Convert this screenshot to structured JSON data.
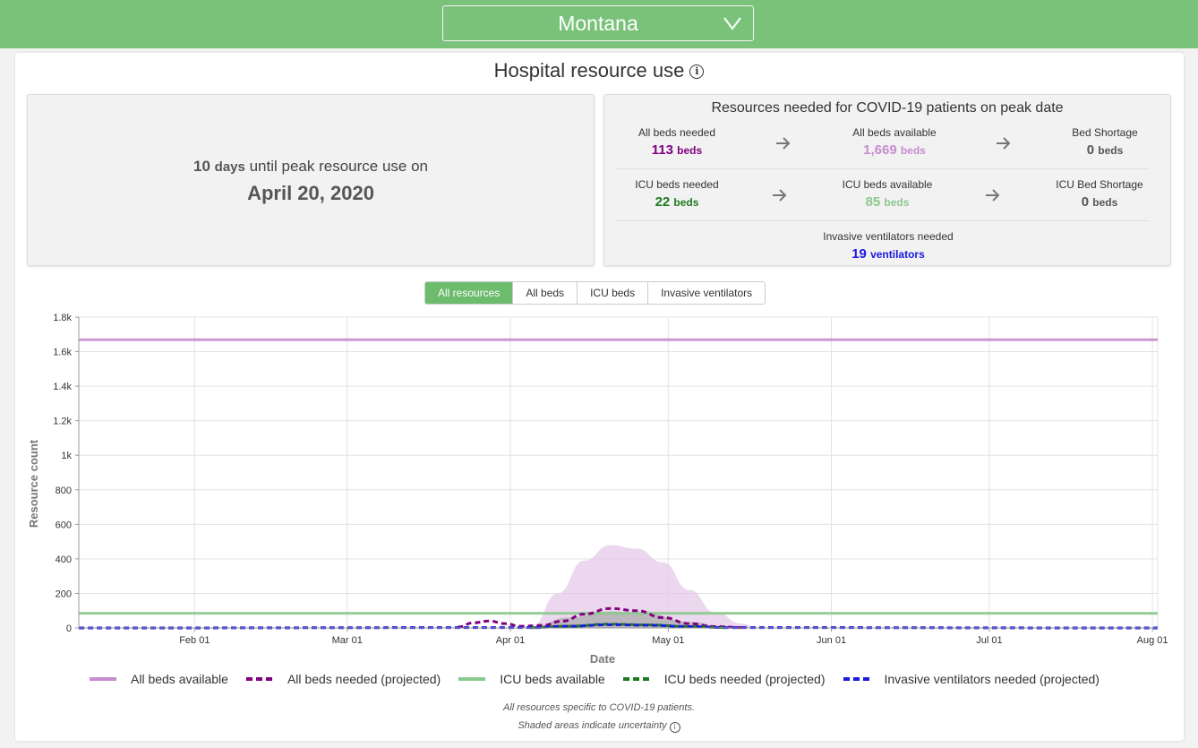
{
  "state_selector": {
    "value": "Montana"
  },
  "title": "Hospital resource use",
  "peak": {
    "days": "10",
    "days_unit": "days",
    "text": "until peak resource use on",
    "date": "April 20, 2020"
  },
  "resources": {
    "title": "Resources needed for COVID-19 patients on peak date",
    "all_beds_needed": {
      "label": "All beds needed",
      "value": "113",
      "unit": "beds"
    },
    "all_beds_available": {
      "label": "All beds available",
      "value": "1,669",
      "unit": "beds"
    },
    "bed_shortage": {
      "label": "Bed Shortage",
      "value": "0",
      "unit": "beds"
    },
    "icu_beds_needed": {
      "label": "ICU beds needed",
      "value": "22",
      "unit": "beds"
    },
    "icu_beds_available": {
      "label": "ICU beds available",
      "value": "85",
      "unit": "beds"
    },
    "icu_bed_shortage": {
      "label": "ICU Bed Shortage",
      "value": "0",
      "unit": "beds"
    },
    "ventilators_needed": {
      "label": "Invasive ventilators needed",
      "value": "19",
      "unit": "ventilators"
    }
  },
  "tabs": [
    {
      "label": "All resources",
      "active": true
    },
    {
      "label": "All beds",
      "active": false
    },
    {
      "label": "ICU beds",
      "active": false
    },
    {
      "label": "Invasive ventilators",
      "active": false
    }
  ],
  "colors": {
    "all_beds": "#c68dce",
    "all_beds_needed": "#800080",
    "icu_beds": "#8cc98c",
    "icu_beds_needed": "#1f7a1f",
    "ventilators": "#1a1ae0",
    "header": "#7ac27a"
  },
  "chart_data": {
    "type": "line",
    "xlabel": "Date",
    "ylabel": "Resource count",
    "x_range": [
      "2020-01-10",
      "2020-08-02"
    ],
    "ylim": [
      0,
      1800
    ],
    "y_ticks": [
      0,
      200,
      400,
      600,
      800,
      1000,
      1200,
      1400,
      1600,
      1800
    ],
    "y_tick_labels": [
      "0",
      "200",
      "400",
      "600",
      "800",
      "1k",
      "1.2k",
      "1.4k",
      "1.6k",
      "1.8k"
    ],
    "x_ticks": [
      "2020-02-01",
      "2020-03-01",
      "2020-04-01",
      "2020-05-01",
      "2020-06-01",
      "2020-07-01",
      "2020-08-01"
    ],
    "x_tick_labels": [
      "Feb 01",
      "Mar 01",
      "Apr 01",
      "May 01",
      "Jun 01",
      "Jul 01",
      "Aug 01"
    ],
    "grid": true,
    "legend_position": "bottom",
    "series": [
      {
        "name": "All beds available",
        "style": "solid",
        "color": "#c68dce",
        "x": [
          "2020-01-10",
          "2020-08-02"
        ],
        "y": [
          1669,
          1669
        ]
      },
      {
        "name": "All beds needed (projected)",
        "style": "dashed",
        "color": "#800080",
        "x": [
          "2020-03-22",
          "2020-03-25",
          "2020-03-28",
          "2020-03-31",
          "2020-04-03",
          "2020-04-07",
          "2020-04-11",
          "2020-04-15",
          "2020-04-20",
          "2020-04-25",
          "2020-04-30",
          "2020-05-05",
          "2020-05-10",
          "2020-05-15"
        ],
        "y": [
          5,
          30,
          40,
          25,
          10,
          15,
          40,
          80,
          113,
          100,
          60,
          25,
          8,
          2
        ]
      },
      {
        "name": "ICU beds available",
        "style": "solid",
        "color": "#8cc98c",
        "x": [
          "2020-01-10",
          "2020-08-02"
        ],
        "y": [
          85,
          85
        ]
      },
      {
        "name": "ICU beds needed (projected)",
        "style": "dashed",
        "color": "#1f7a1f",
        "x": [
          "2020-04-05",
          "2020-04-12",
          "2020-04-20",
          "2020-04-27",
          "2020-05-05",
          "2020-05-12"
        ],
        "y": [
          2,
          10,
          22,
          18,
          8,
          2
        ]
      },
      {
        "name": "Invasive ventilators needed (projected)",
        "style": "dashed",
        "color": "#1a1ae0",
        "x": [
          "2020-01-10",
          "2020-04-05",
          "2020-04-12",
          "2020-04-20",
          "2020-04-27",
          "2020-05-05",
          "2020-05-12",
          "2020-08-02"
        ],
        "y": [
          0,
          2,
          10,
          19,
          16,
          8,
          2,
          0
        ]
      }
    ],
    "uncertainty": [
      {
        "series": "All beds needed (projected)",
        "color": "#e3c6e7",
        "x": [
          "2020-04-05",
          "2020-04-10",
          "2020-04-15",
          "2020-04-20",
          "2020-04-25",
          "2020-04-30",
          "2020-05-05",
          "2020-05-10",
          "2020-05-15",
          "2020-05-18"
        ],
        "upper": [
          5,
          200,
          390,
          480,
          460,
          380,
          220,
          90,
          25,
          0
        ],
        "lower": [
          0,
          0,
          0,
          0,
          0,
          0,
          0,
          0,
          0,
          0
        ]
      },
      {
        "series": "ICU beds needed (projected)",
        "color": "#a8a8a8",
        "x": [
          "2020-04-05",
          "2020-04-12",
          "2020-04-20",
          "2020-04-27",
          "2020-05-05",
          "2020-05-12"
        ],
        "upper": [
          3,
          60,
          95,
          80,
          35,
          3
        ],
        "lower": [
          0,
          0,
          0,
          0,
          0,
          0
        ]
      }
    ]
  },
  "footnotes": [
    "All resources specific to COVID-19 patients.",
    "Shaded areas indicate uncertainty"
  ]
}
